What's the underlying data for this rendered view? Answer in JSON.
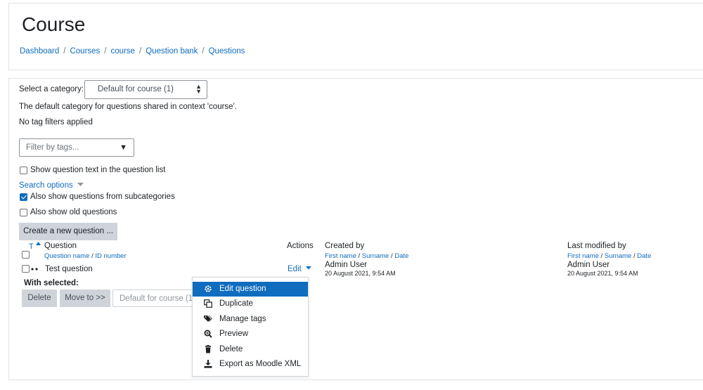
{
  "page": {
    "title": "Course",
    "breadcrumb": [
      "Dashboard",
      "Courses",
      "course",
      "Question bank",
      "Questions"
    ],
    "breadcrumb_separator": "/"
  },
  "category": {
    "label": "Select a category:",
    "selected": "Default for course (1)",
    "description": "The default category for questions shared in context 'course'."
  },
  "tags": {
    "status": "No tag filters applied",
    "filter_placeholder": "Filter by tags..."
  },
  "options": {
    "show_question_text": {
      "label": "Show question text in the question list",
      "checked": false
    },
    "search_options_label": "Search options",
    "show_subcategories": {
      "label": "Also show questions from subcategories",
      "checked": true
    },
    "show_old": {
      "label": "Also show old questions",
      "checked": false
    }
  },
  "create_button_label": "Create a new question ...",
  "table": {
    "type_header": "T",
    "question_header": "Question",
    "question_sub": [
      "Question name",
      "ID number"
    ],
    "actions_header": "Actions",
    "created_header": "Created by",
    "created_sub": [
      "First name",
      "Surname",
      "Date"
    ],
    "modified_header": "Last modified by",
    "modified_sub": [
      "First name",
      "Surname",
      "Date"
    ],
    "rows": [
      {
        "name": "Test question",
        "action": "Edit",
        "created_by": "Admin User",
        "created_date": "20 August 2021, 9:54 AM",
        "modified_by": "Admin User",
        "modified_date": "20 August 2021, 9:54 AM"
      }
    ]
  },
  "with_selected": {
    "label": "With selected:",
    "delete_label": "Delete",
    "move_label": "Move to >>",
    "target": "Default for course (1)"
  },
  "edit_menu": {
    "items": [
      {
        "label": "Edit question",
        "icon": "gear-icon"
      },
      {
        "label": "Duplicate",
        "icon": "copy-icon"
      },
      {
        "label": "Manage tags",
        "icon": "tags-icon"
      },
      {
        "label": "Preview",
        "icon": "magnifier-icon"
      },
      {
        "label": "Delete",
        "icon": "trash-icon"
      },
      {
        "label": "Export as Moodle XML",
        "icon": "download-icon"
      }
    ],
    "active_index": 0
  },
  "colors": {
    "link": "#0f6cbf",
    "active_menu_bg": "#0f6cbf",
    "button_bg": "#ced4da",
    "border": "#dee2e6"
  }
}
